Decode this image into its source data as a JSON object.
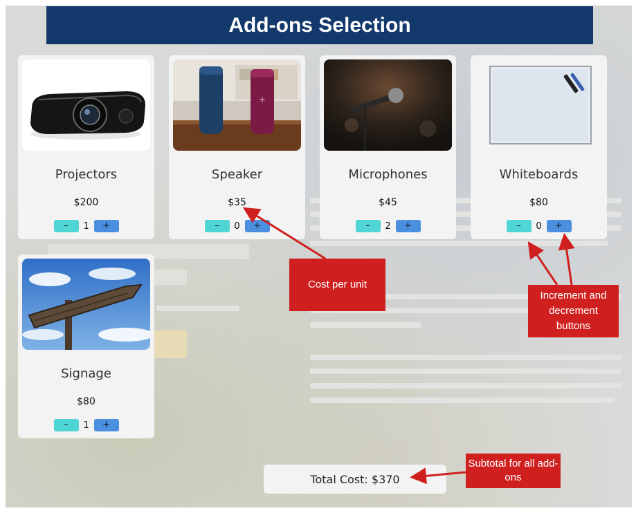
{
  "header": {
    "title": "Add-ons Selection"
  },
  "products": [
    {
      "name": "Projectors",
      "price": "$200",
      "qty": "1",
      "image": "projector-image"
    },
    {
      "name": "Speaker",
      "price": "$35",
      "qty": "0",
      "image": "speaker-image"
    },
    {
      "name": "Microphones",
      "price": "$45",
      "qty": "2",
      "image": "microphone-image"
    },
    {
      "name": "Whiteboards",
      "price": "$80",
      "qty": "0",
      "image": "whiteboard-image"
    },
    {
      "name": "Signage",
      "price": "$80",
      "qty": "1",
      "image": "signage-image"
    }
  ],
  "controls": {
    "decrement_label": "–",
    "increment_label": "+"
  },
  "total": {
    "label": "Total Cost: $370"
  },
  "callouts": {
    "cost_per_unit": "Cost per unit",
    "inc_dec": "Increment and decrement buttons",
    "subtotal": "Subtotal for all add-ons"
  },
  "colors": {
    "header_bg": "#13386b",
    "decrement": "#4fd6d4",
    "increment": "#4a8fe0",
    "callout": "#cf1f1f"
  }
}
